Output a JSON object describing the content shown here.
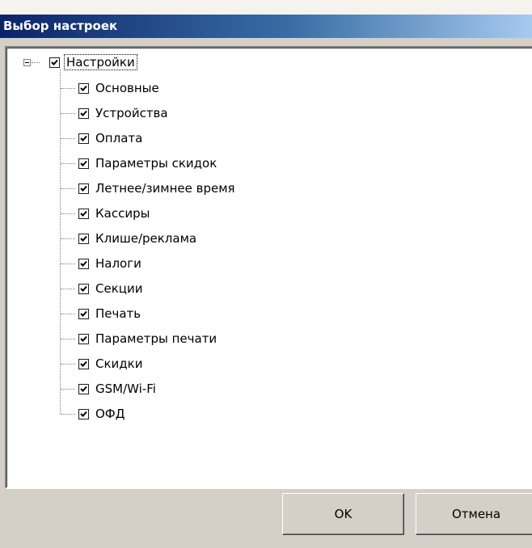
{
  "window": {
    "title": "Выбор настроек"
  },
  "tree": {
    "root": {
      "label": "Настройки",
      "checked": true,
      "expanded": true
    },
    "items": [
      {
        "label": "Основные",
        "checked": true
      },
      {
        "label": "Устройства",
        "checked": true
      },
      {
        "label": "Оплата",
        "checked": true
      },
      {
        "label": "Параметры скидок",
        "checked": true
      },
      {
        "label": "Летнее/зимнее время",
        "checked": true
      },
      {
        "label": "Кассиры",
        "checked": true
      },
      {
        "label": "Клише/реклама",
        "checked": true
      },
      {
        "label": "Налоги",
        "checked": true
      },
      {
        "label": "Секции",
        "checked": true
      },
      {
        "label": "Печать",
        "checked": true
      },
      {
        "label": "Параметры печати",
        "checked": true
      },
      {
        "label": "Скидки",
        "checked": true
      },
      {
        "label": "GSM/Wi-Fi",
        "checked": true
      },
      {
        "label": "ОФД",
        "checked": true
      }
    ]
  },
  "buttons": {
    "ok_label": "OK",
    "cancel_label": "Отмена"
  },
  "icons": {
    "checkmark": "checkmark-icon",
    "collapse": "minus-box-icon"
  }
}
